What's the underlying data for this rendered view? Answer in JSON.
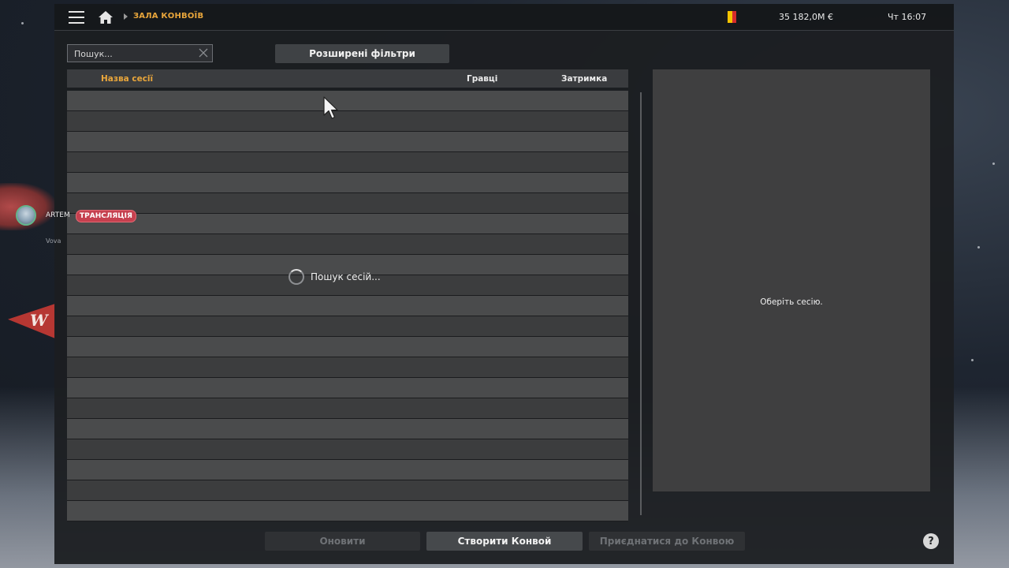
{
  "breadcrumb": {
    "title": "ЗАЛА КОНВОЇВ"
  },
  "topbar": {
    "money": "35 182,0M €",
    "clock": "Чт 16:07",
    "flag_colors": [
      "#1a1a1a",
      "#f5c400",
      "#d62b2b"
    ]
  },
  "search": {
    "placeholder": "Пошук..."
  },
  "filters": {
    "advanced_label": "Розширені фільтри"
  },
  "table": {
    "headers": {
      "name": "Назва сесії",
      "players": "Гравці",
      "latency": "Затримка"
    },
    "rows": [],
    "visible_empty_rows": 21
  },
  "loading": {
    "text": "Пошук сесій..."
  },
  "details": {
    "empty_text": "Оберіть сесію."
  },
  "actions": {
    "refresh": "Оновити",
    "create": "Створити Конвой",
    "join": "Приєднатися до Конвою",
    "help": "?"
  },
  "stream": {
    "user": "ARTEM",
    "badge": "ТРАНСЛЯЦІЯ",
    "sub_user": "Vova"
  },
  "colors": {
    "accent": "#e9a63b",
    "live": "#c6404f"
  }
}
